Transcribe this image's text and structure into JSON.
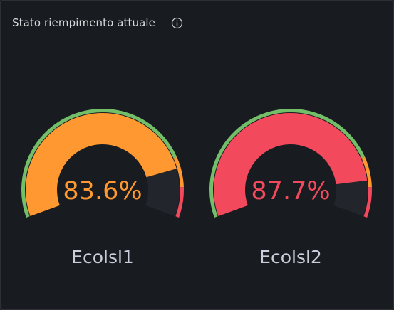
{
  "panel": {
    "title": "Stato riempimento attuale",
    "info_icon": "info-circle-icon"
  },
  "colors": {
    "green": "#73bf69",
    "orange": "#ff9830",
    "red": "#f2495c",
    "empty": "#22252b"
  },
  "thresholds": [
    {
      "from": 0,
      "to": 80,
      "color": "green"
    },
    {
      "from": 80,
      "to": 90,
      "color": "orange"
    },
    {
      "from": 90,
      "to": 100,
      "color": "red"
    }
  ],
  "gauges": [
    {
      "name": "Ecolsl1",
      "value": 83.6,
      "display": "83.6%",
      "color": "#ff9830"
    },
    {
      "name": "Ecolsl2",
      "value": 87.7,
      "display": "87.7%",
      "color": "#f2495c"
    }
  ]
}
